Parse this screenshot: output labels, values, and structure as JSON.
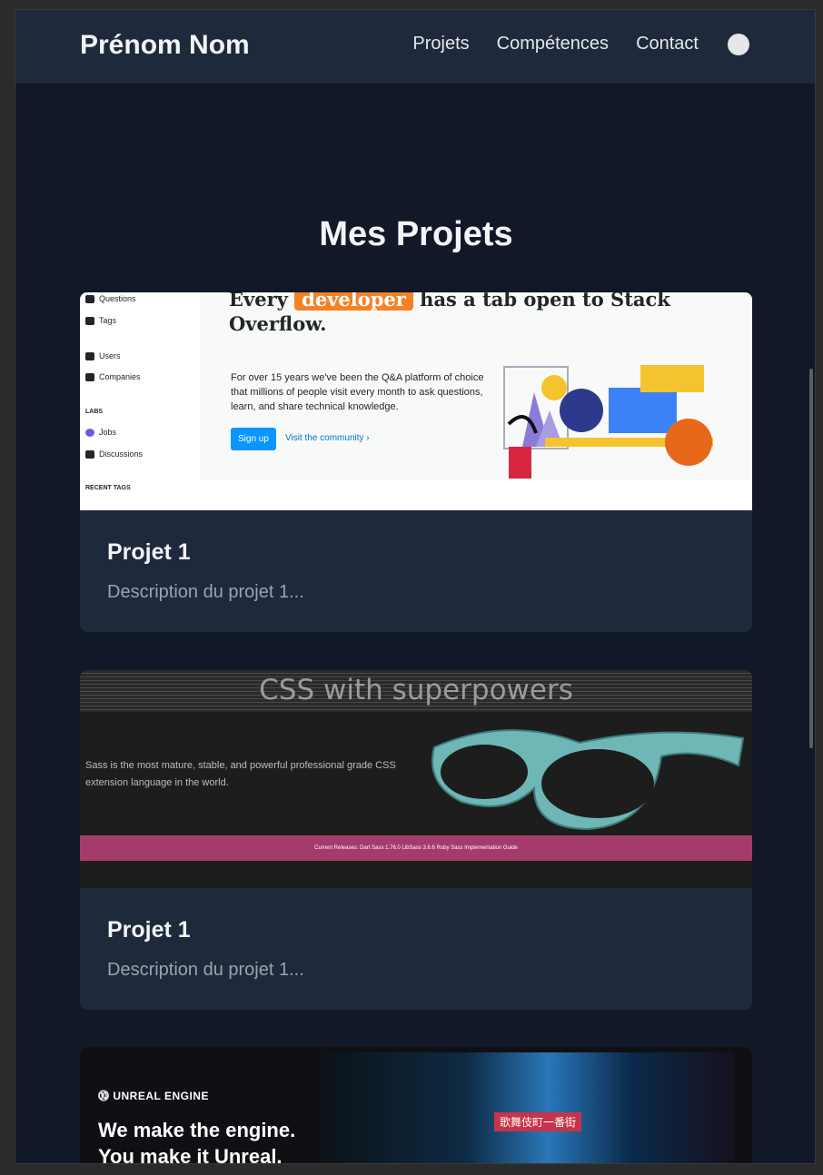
{
  "nav": {
    "brand": "Prénom Nom",
    "links": [
      "Projets",
      "Compétences",
      "Contact"
    ]
  },
  "section_title": "Mes Projets",
  "projects": [
    {
      "title": "Projet 1",
      "description": "Description du projet 1...",
      "image": {
        "sidebar": [
          "Questions",
          "Tags",
          "Users",
          "Companies",
          "LABS",
          "Jobs",
          "Discussions",
          "RECENT TAGS"
        ],
        "headline_pre": "Every",
        "headline_tag": "developer",
        "headline_post": "has a tab open to Stack Overflow.",
        "paragraph": "For over 15 years we've been the Q&A platform of choice that millions of people visit every month to ask questions, learn, and share technical knowledge.",
        "button": "Sign up",
        "link": "Visit the community ›"
      }
    },
    {
      "title": "Projet 1",
      "description": "Description du projet 1...",
      "image": {
        "title": "CSS with superpowers",
        "paragraph": "Sass is the most mature, stable, and powerful professional grade CSS extension language in the world.",
        "band": "Current Releases:   Dart Sass 1.76.0   LibSass 3.6.6   Ruby Sass   Implementation Guide"
      }
    },
    {
      "image": {
        "logo": "UNREAL ENGINE",
        "headline": "We make the engine. You make it Unreal.",
        "sign": "歌舞伎町一番街"
      }
    }
  ]
}
